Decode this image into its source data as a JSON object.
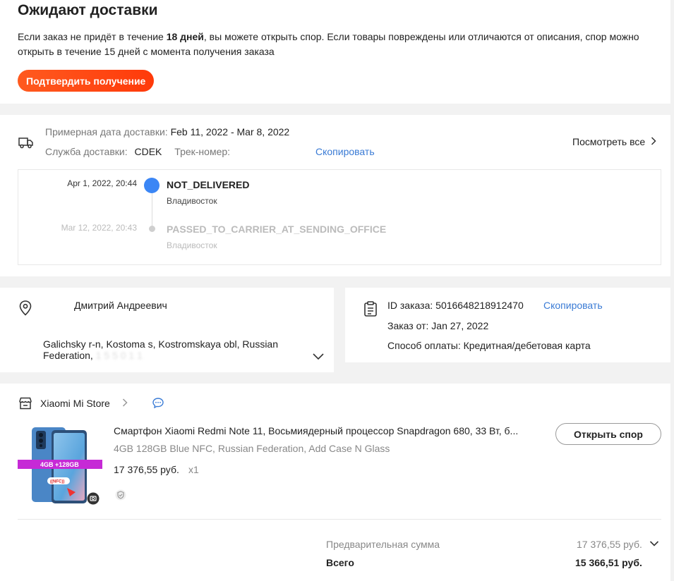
{
  "header": {
    "title": "Ожидают доставки",
    "info_prefix": "Если заказ не придёт в течение ",
    "info_bold": "18 дней",
    "info_suffix": ", вы можете открыть спор. Если товары повреждены или отличаются от описания, спор можно открыть в течение 15 дней с момента получения заказа",
    "confirm_label": "Подтвердить получение"
  },
  "delivery": {
    "date_label": "Примерная дата доставки:",
    "date_value": "Feb 11, 2022 - Mar 8, 2022",
    "service_label": "Служба доставки:",
    "service_value": "CDEK",
    "track_label": "Трек-номер:",
    "copy_label": "Скопировать",
    "view_all_label": "Посмотреть все",
    "timeline": [
      {
        "date": "Apr 1, 2022, 20:44",
        "status": "NOT_DELIVERED",
        "city": "Владивосток"
      },
      {
        "date": "Mar 12, 2022, 20:43",
        "status": "PASSED_TO_CARRIER_AT_SENDING_OFFICE",
        "city": "Владивосток"
      }
    ]
  },
  "address": {
    "name": "Дмитрий Андреевич",
    "line": "Galichsky r-n, Kostoma s, Kostromskaya obl, Russian Federation,",
    "postcode_masked": "1 5 5 0 1 1"
  },
  "order": {
    "id_label": "ID заказа:",
    "id_value": "5016648218912470",
    "copy_label": "Скопировать",
    "date_label": "Заказ от:",
    "date_value": "Jan 27, 2022",
    "payment_label": "Способ оплаты:",
    "payment_value": "Кредитная/дебетовая карта"
  },
  "product": {
    "store_name": "Xiaomi Mi Store",
    "title": "Смартфон Xiaomi Redmi Note 11, Восьмиядерный процессор Snapdragon 680, 33 Вт, б...",
    "spec": "4GB 128GB Blue NFC, Russian Federation, Add Case N Glass",
    "price": "17 376,55 руб.",
    "qty": "x1",
    "image_badge": "4GB +128GB",
    "nfc_label": "((NFC))",
    "dispute_label": "Открыть спор"
  },
  "summary": {
    "subtotal_label": "Предварительная сумма",
    "subtotal_value": "17 376,55 руб.",
    "total_label": "Всего",
    "total_value": "15 366,51 руб."
  },
  "colors": {
    "accent_orange": "#ff4a14",
    "link_blue": "#3a7bd5",
    "timeline_blue": "#3b86f5"
  }
}
